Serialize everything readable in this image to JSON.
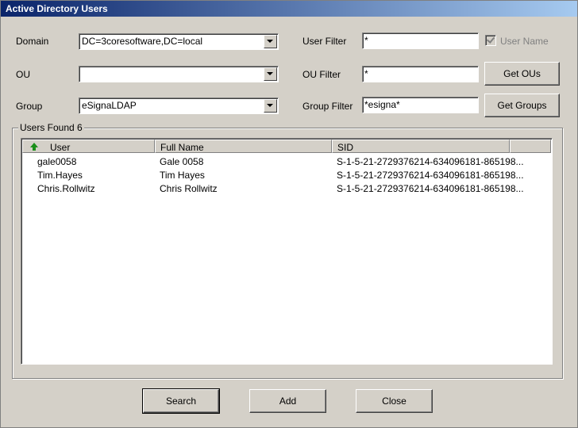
{
  "window": {
    "title": "Active Directory Users"
  },
  "filters": {
    "domain_label": "Domain",
    "domain_value": "DC=3coresoftware,DC=local",
    "ou_label": "OU",
    "ou_value": "",
    "group_label": "Group",
    "group_value": "eSignaLDAP",
    "user_filter_label": "User Filter",
    "user_filter_value": "*",
    "user_name_checkbox_label": "User Name",
    "user_name_checked": true,
    "ou_filter_label": "OU Filter",
    "ou_filter_value": "*",
    "group_filter_label": "Group Filter",
    "group_filter_value": "*esigna*"
  },
  "buttons": {
    "get_ous": "Get OUs",
    "get_groups": "Get Groups",
    "search": "Search",
    "add": "Add",
    "close": "Close"
  },
  "results": {
    "group_label": "Users Found 6",
    "columns": [
      "User",
      "Full Name",
      "SID"
    ],
    "sort_icon": "sort-ascending-arrow-icon",
    "rows": [
      [
        "gale0058",
        "Gale 0058",
        "S-1-5-21-2729376214-634096181-865198..."
      ],
      [
        "Tim.Hayes",
        "Tim Hayes",
        "S-1-5-21-2729376214-634096181-865198..."
      ],
      [
        "Chris.Rollwitz",
        "Chris Rollwitz",
        "S-1-5-21-2729376214-634096181-865198..."
      ]
    ]
  }
}
